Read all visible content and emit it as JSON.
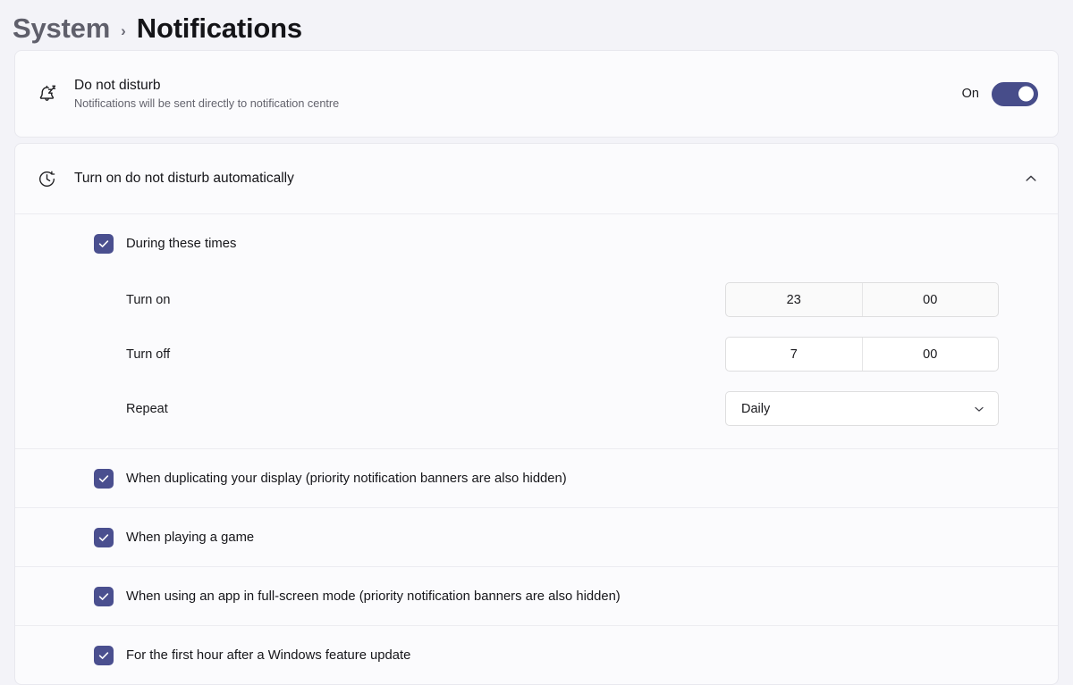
{
  "breadcrumb": {
    "parent": "System",
    "separator": "›",
    "current": "Notifications"
  },
  "colors": {
    "accent": "#474d8a",
    "checkbox": "#4a4f8f",
    "page_background": "#f3f3f8",
    "card_background": "#fbfbfd",
    "divider": "#ececf1"
  },
  "do_not_disturb": {
    "icon": "bell-with-z-icon",
    "title": "Do not disturb",
    "subtitle": "Notifications will be sent directly to notification centre",
    "toggle_label": "On",
    "toggle_state": "on"
  },
  "auto_dnd": {
    "icon": "clock-icon",
    "title": "Turn on do not disturb automatically",
    "expanded": true,
    "chevron": "chevron-up-icon",
    "during_times": {
      "label": "During these times",
      "checked": true,
      "settings": [
        {
          "label": "Turn on",
          "type": "time",
          "hour": "23",
          "minute": "00"
        },
        {
          "label": "Turn off",
          "type": "time",
          "hour": "7",
          "minute": "00"
        },
        {
          "label": "Repeat",
          "type": "select",
          "value": "Daily",
          "chevron": "chevron-down-icon"
        }
      ]
    },
    "conditions": [
      {
        "label": "When duplicating your display (priority notification banners are also hidden)",
        "checked": true
      },
      {
        "label": "When playing a game",
        "checked": true
      },
      {
        "label": "When using an app in full-screen mode (priority notification banners are also hidden)",
        "checked": true
      },
      {
        "label": "For the first hour after a Windows feature update",
        "checked": true
      }
    ]
  }
}
